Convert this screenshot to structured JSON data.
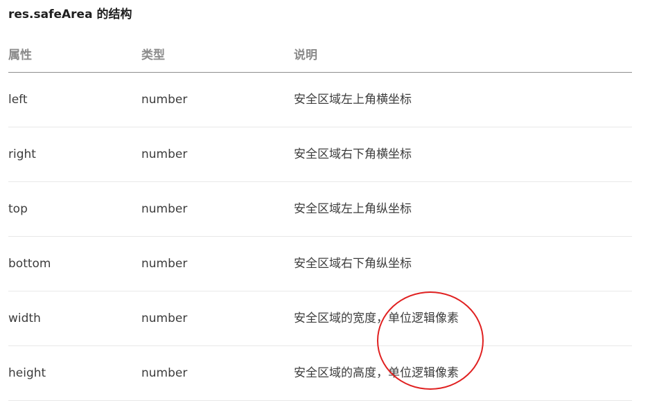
{
  "title": "res.safeArea 的结构",
  "table": {
    "headers": {
      "property": "属性",
      "type": "类型",
      "description": "说明"
    },
    "rows": [
      {
        "property": "left",
        "type": "number",
        "description": "安全区域左上角横坐标"
      },
      {
        "property": "right",
        "type": "number",
        "description": "安全区域右下角横坐标"
      },
      {
        "property": "top",
        "type": "number",
        "description": "安全区域左上角纵坐标"
      },
      {
        "property": "bottom",
        "type": "number",
        "description": "安全区域右下角纵坐标"
      },
      {
        "property": "width",
        "type": "number",
        "description": "安全区域的宽度，单位逻辑像素"
      },
      {
        "property": "height",
        "type": "number",
        "description": "安全区域的高度，单位逻辑像素"
      }
    ]
  },
  "annotation": {
    "shape": "circle",
    "color": "#e02020"
  }
}
